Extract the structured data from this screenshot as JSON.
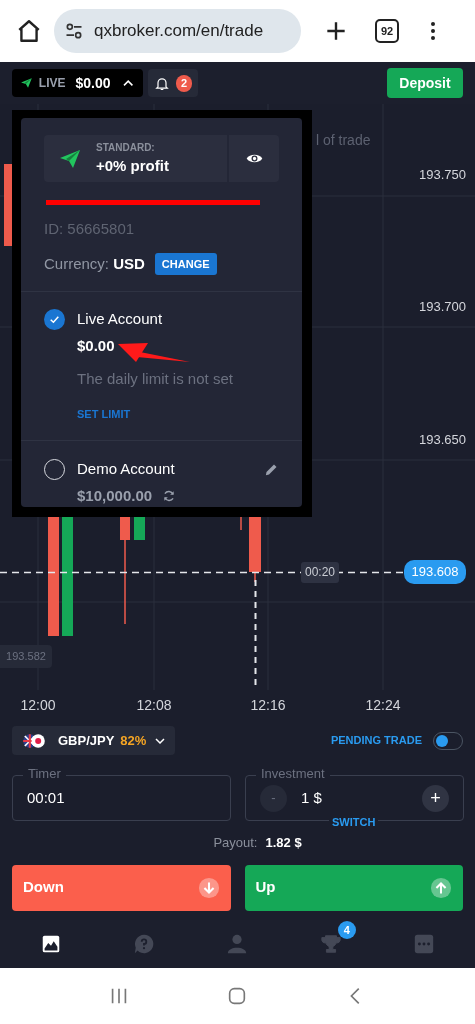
{
  "browser": {
    "url": "qxbroker.com/en/trade",
    "tab_count": "92"
  },
  "header": {
    "account_label": "LIVE",
    "balance": "$0.00",
    "notifications": "2",
    "deposit": "Deposit"
  },
  "chart": {
    "partial_text": "l of trade",
    "price_labels": [
      "193.750",
      "193.700",
      "193.650"
    ],
    "time_labels": [
      "12:00",
      "12:08",
      "12:16",
      "12:24"
    ],
    "countdown": "00:20",
    "current_price": "193.608",
    "low_price": "193.582"
  },
  "account_menu": {
    "plan_label": "STANDARD:",
    "plan_value": "+0% profit",
    "account_id": "ID: 56665801",
    "currency_label": "Currency:",
    "currency": "USD",
    "change": "CHANGE",
    "accounts": [
      {
        "kind": "live",
        "name": "Live Account",
        "balance": "$0.00",
        "selected": true,
        "limit_text": "The daily limit is not set",
        "limit_action": "SET LIMIT"
      },
      {
        "kind": "demo",
        "name": "Demo Account",
        "balance": "$10,000.00",
        "selected": false
      }
    ]
  },
  "trade": {
    "asset": "GBP/JPY",
    "payout_percent": "82%",
    "pending_label": "PENDING TRADE",
    "pending_on": false,
    "timer_label": "Timer",
    "timer": "00:01",
    "investment_label": "Investment",
    "minus": "-",
    "investment": "1 $",
    "plus": "+",
    "switch": "SWITCH",
    "payout_label": "Payout:",
    "payout": "1.82 $",
    "down": "Down",
    "up": "Up"
  },
  "bottom_nav": [
    {
      "kind": "chart",
      "selected": true
    },
    {
      "kind": "help",
      "selected": false
    },
    {
      "kind": "profile",
      "selected": false
    },
    {
      "kind": "trophy",
      "selected": false,
      "badge": "4"
    },
    {
      "kind": "more",
      "selected": false
    }
  ]
}
